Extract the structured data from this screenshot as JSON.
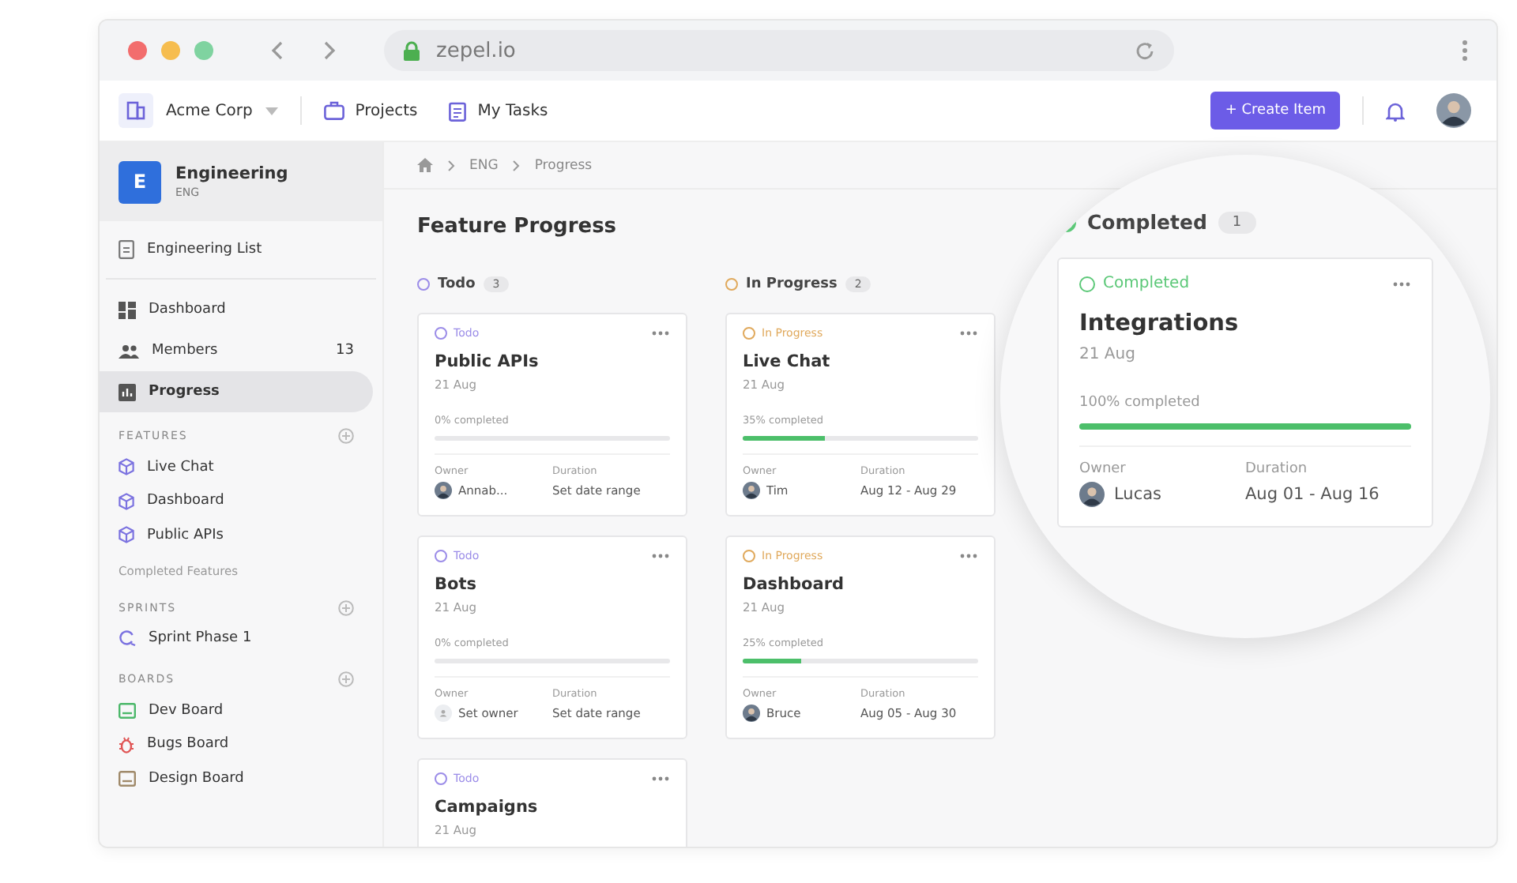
{
  "browser": {
    "url": "zepel.io"
  },
  "header": {
    "workspace": "Acme Corp",
    "nav": [
      {
        "label": "Projects",
        "kind": "briefcase"
      },
      {
        "label": "My Tasks",
        "kind": "clipboard"
      }
    ],
    "create_button": "+ Create Item"
  },
  "sidebar": {
    "team": {
      "initial": "E",
      "name": "Engineering",
      "code": "ENG"
    },
    "list_link": "Engineering List",
    "nav": [
      {
        "label": "Dashboard",
        "kind": "grid",
        "selected": false
      },
      {
        "label": "Members",
        "kind": "people",
        "count": "13",
        "selected": false
      },
      {
        "label": "Progress",
        "kind": "chart",
        "selected": true
      }
    ],
    "sections": [
      {
        "title": "FEATURES",
        "items": [
          {
            "label": "Live Chat",
            "kind": "cube"
          },
          {
            "label": "Dashboard",
            "kind": "cube"
          },
          {
            "label": "Public APIs",
            "kind": "cube"
          }
        ],
        "footer_link": "Completed Features"
      },
      {
        "title": "SPRINTS",
        "items": [
          {
            "label": "Sprint Phase 1",
            "kind": "sprint"
          }
        ]
      },
      {
        "title": "BOARDS",
        "items": [
          {
            "label": "Dev Board",
            "kind": "dev"
          },
          {
            "label": "Bugs Board",
            "kind": "bug"
          },
          {
            "label": "Design Board",
            "kind": "design"
          }
        ]
      }
    ]
  },
  "breadcrumb": [
    "ENG",
    "Progress"
  ],
  "page_title": "Feature Progress",
  "columns": [
    {
      "name": "Todo",
      "count": "3",
      "color": "#9b8ce8",
      "cards": [
        {
          "status": "Todo",
          "title": "Public APIs",
          "date": "21 Aug",
          "progress_text": "0% completed",
          "level": 0,
          "owner_label": "Owner",
          "owner": "Annab...",
          "has_avatar": true,
          "duration_label": "Duration",
          "duration": "Set date range"
        },
        {
          "status": "Todo",
          "title": "Bots",
          "date": "21 Aug",
          "progress_text": "0% completed",
          "level": 0,
          "owner_label": "Owner",
          "owner": "Set owner",
          "has_avatar": false,
          "duration_label": "Duration",
          "duration": "Set date range"
        },
        {
          "status": "Todo",
          "title": "Campaigns",
          "date": "21 Aug"
        }
      ]
    },
    {
      "name": "In Progress",
      "count": "2",
      "color": "#e0a95c",
      "cards": [
        {
          "status": "In Progress",
          "title": "Live Chat",
          "date": "21 Aug",
          "progress_text": "35% completed",
          "level": 0.35,
          "owner_label": "Owner",
          "owner": "Tim",
          "has_avatar": true,
          "duration_label": "Duration",
          "duration": "Aug 12 - Aug 29"
        },
        {
          "status": "In Progress",
          "title": "Dashboard",
          "date": "21 Aug",
          "progress_text": "25% completed",
          "level": 0.25,
          "owner_label": "Owner",
          "owner": "Bruce",
          "has_avatar": true,
          "duration_label": "Duration",
          "duration": "Aug 05 - Aug 30"
        }
      ]
    }
  ],
  "magnifier": {
    "column": {
      "name": "Completed",
      "count": "1",
      "color": "#5cc878",
      "cards": [
        {
          "status": "Completed",
          "title": "Integrations",
          "date": "21 Aug",
          "progress_text": "100% completed",
          "level": 1,
          "owner_label": "Owner",
          "owner": "Lucas",
          "has_avatar": true,
          "duration_label": "Duration",
          "duration": "Aug 01 - Aug 16"
        }
      ]
    }
  }
}
